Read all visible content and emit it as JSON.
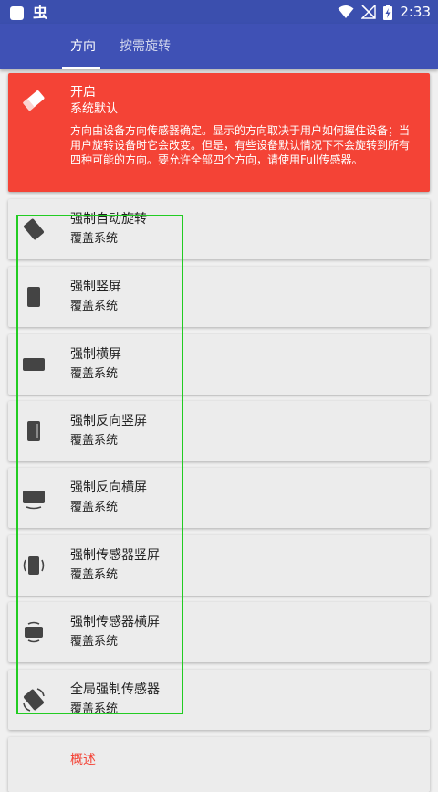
{
  "status_bar": {
    "time": "2:33",
    "notif_glyph": "虫"
  },
  "tabs": [
    {
      "label": "方向",
      "active": true
    },
    {
      "label": "按需旋转",
      "active": false
    }
  ],
  "default_card": {
    "icon": "eraser-icon",
    "title": "开启",
    "subtitle": "系统默认",
    "description": "方向由设备方向传感器确定。显示的方向取决于用户如何握住设备；当用户旋转设备时它会改变。但是，有些设备默认情况下不会旋转到所有四种可能的方向。要允许全部四个方向，请使用Full传感器。"
  },
  "options": [
    {
      "icon": "auto-rotate-phone-icon",
      "title": "强制自动旋转",
      "subtitle": "覆盖系统"
    },
    {
      "icon": "portrait-phone-icon",
      "title": "强制竖屏",
      "subtitle": "覆盖系统"
    },
    {
      "icon": "landscape-phone-icon",
      "title": "强制横屏",
      "subtitle": "覆盖系统"
    },
    {
      "icon": "reverse-portrait-icon",
      "title": "强制反向竖屏",
      "subtitle": "覆盖系统"
    },
    {
      "icon": "reverse-landscape-icon",
      "title": "强制反向横屏",
      "subtitle": "覆盖系统"
    },
    {
      "icon": "sensor-portrait-icon",
      "title": "强制传感器竖屏",
      "subtitle": "覆盖系统"
    },
    {
      "icon": "sensor-landscape-icon",
      "title": "强制传感器横屏",
      "subtitle": "覆盖系统"
    },
    {
      "icon": "full-sensor-icon",
      "title": "全局强制传感器",
      "subtitle": "覆盖系统"
    }
  ],
  "overview": {
    "label": "概述"
  },
  "colors": {
    "appbar": "#3f51b5",
    "status_bar": "#3b4fae",
    "accent_red": "#f44336",
    "highlight": "#22cc22"
  }
}
